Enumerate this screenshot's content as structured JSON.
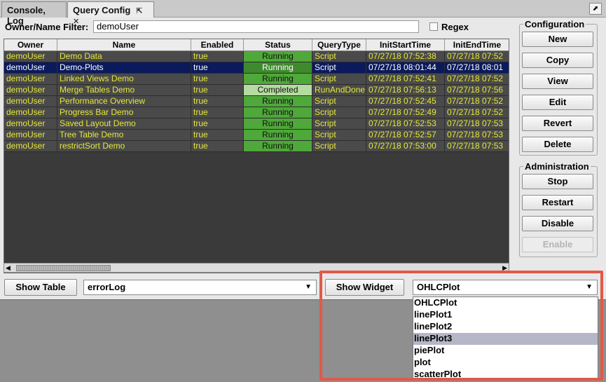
{
  "tabs": [
    {
      "label": "Console, Log",
      "active": false
    },
    {
      "label": "Query Config",
      "active": true,
      "icons": "⇱ ✕"
    }
  ],
  "corner_button": "⬈",
  "filter": {
    "label": "Owner/Name Filter:",
    "value": "demoUser",
    "regex_label": "Regex",
    "regex_checked": false
  },
  "table": {
    "columns": [
      "Owner",
      "Name",
      "Enabled",
      "Status",
      "QueryType",
      "InitStartTime",
      "InitEndTime"
    ],
    "rows": [
      {
        "owner": "demoUser",
        "name": "Demo Data",
        "enabled": "true",
        "status": "Running",
        "type": "Script",
        "start": "07/27/18 07:52:38",
        "end": "07/27/18 07:52",
        "selected": false
      },
      {
        "owner": "demoUser",
        "name": "Demo-Plots",
        "enabled": "true",
        "status": "Running",
        "type": "Script",
        "start": "07/27/18 08:01:44",
        "end": "07/27/18 08:01",
        "selected": true
      },
      {
        "owner": "demoUser",
        "name": "Linked Views Demo",
        "enabled": "true",
        "status": "Running",
        "type": "Script",
        "start": "07/27/18 07:52:41",
        "end": "07/27/18 07:52",
        "selected": false
      },
      {
        "owner": "demoUser",
        "name": "Merge Tables Demo",
        "enabled": "true",
        "status": "Completed",
        "type": "RunAndDone",
        "start": "07/27/18 07:56:13",
        "end": "07/27/18 07:56",
        "selected": false
      },
      {
        "owner": "demoUser",
        "name": "Performance Overview",
        "enabled": "true",
        "status": "Running",
        "type": "Script",
        "start": "07/27/18 07:52:45",
        "end": "07/27/18 07:52",
        "selected": false
      },
      {
        "owner": "demoUser",
        "name": "Progress Bar Demo",
        "enabled": "true",
        "status": "Running",
        "type": "Script",
        "start": "07/27/18 07:52:49",
        "end": "07/27/18 07:52",
        "selected": false
      },
      {
        "owner": "demoUser",
        "name": "Saved Layout Demo",
        "enabled": "true",
        "status": "Running",
        "type": "Script",
        "start": "07/27/18 07:52:53",
        "end": "07/27/18 07:53",
        "selected": false
      },
      {
        "owner": "demoUser",
        "name": "Tree Table Demo",
        "enabled": "true",
        "status": "Running",
        "type": "Script",
        "start": "07/27/18 07:52:57",
        "end": "07/27/18 07:53",
        "selected": false
      },
      {
        "owner": "demoUser",
        "name": "restrictSort Demo",
        "enabled": "true",
        "status": "Running",
        "type": "Script",
        "start": "07/27/18 07:53:00",
        "end": "07/27/18 07:53",
        "selected": false
      }
    ]
  },
  "configuration": {
    "title": "Configuration",
    "buttons": [
      "New",
      "Copy",
      "View",
      "Edit",
      "Revert",
      "Delete"
    ]
  },
  "administration": {
    "title": "Administration",
    "buttons": [
      "Stop",
      "Restart",
      "Disable",
      "Enable"
    ],
    "disabled": [
      "Enable"
    ]
  },
  "bottom": {
    "show_table_label": "Show Table",
    "table_select_value": "errorLog",
    "show_widget_label": "Show Widget",
    "widget_select_value": "OHLCPlot",
    "widget_options": [
      "OHLCPlot",
      "linePlot1",
      "linePlot2",
      "linePlot3",
      "piePlot",
      "plot",
      "scatterPlot"
    ],
    "highlighted_option": "linePlot3"
  },
  "colors": {
    "running": "#4fa83a",
    "completed": "#b5dca0",
    "row_text": "#e4e83a",
    "selected_row": "#0b1a5c",
    "highlight_border": "#e05a4a"
  }
}
